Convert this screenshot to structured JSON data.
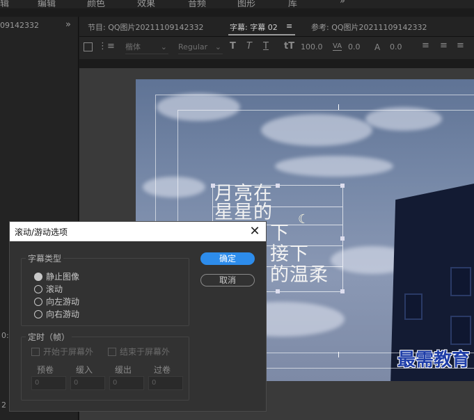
{
  "menubar": {
    "items": [
      "辑",
      "编辑",
      "颜色",
      "效果",
      "音频",
      "图形",
      "库",
      "»"
    ]
  },
  "left_panel": {
    "tab": "09142332",
    "more": "»",
    "marker": "0:",
    "bottom": "2"
  },
  "tabs": {
    "program": "节目: QQ图片20211109142332",
    "caption": "字幕: 字幕 02",
    "caption_menu": "≡",
    "reference": "参考: QQ图片20211109142332"
  },
  "toolbar": {
    "font_family": "楷体",
    "font_style": "Regular",
    "font_size": "100.0",
    "kerning": "0.0",
    "leading": "0.0",
    "icons": [
      "T",
      "T",
      "T",
      "tT",
      "VA",
      "A"
    ]
  },
  "canvas": {
    "title_lines": [
      "月亮在",
      "星星的",
      "下",
      "接下",
      "的温柔"
    ],
    "moon": "☾",
    "watermark": "最需教育"
  },
  "dialog": {
    "title": "滚动/游动选项",
    "close": "✕",
    "subtitle_type": {
      "label": "字幕类型",
      "options": [
        "静止图像",
        "滚动",
        "向左游动",
        "向右游动"
      ],
      "selected": "静止图像"
    },
    "timing": {
      "label": "定时（帧）",
      "start_offscreen": "开始于屏幕外",
      "end_offscreen": "结束于屏幕外",
      "fields": [
        {
          "label": "预卷",
          "value": "0"
        },
        {
          "label": "缓入",
          "value": "0"
        },
        {
          "label": "缓出",
          "value": "0"
        },
        {
          "label": "过卷",
          "value": "0"
        }
      ]
    },
    "ok_label": "确定",
    "cancel_label": "取消"
  }
}
